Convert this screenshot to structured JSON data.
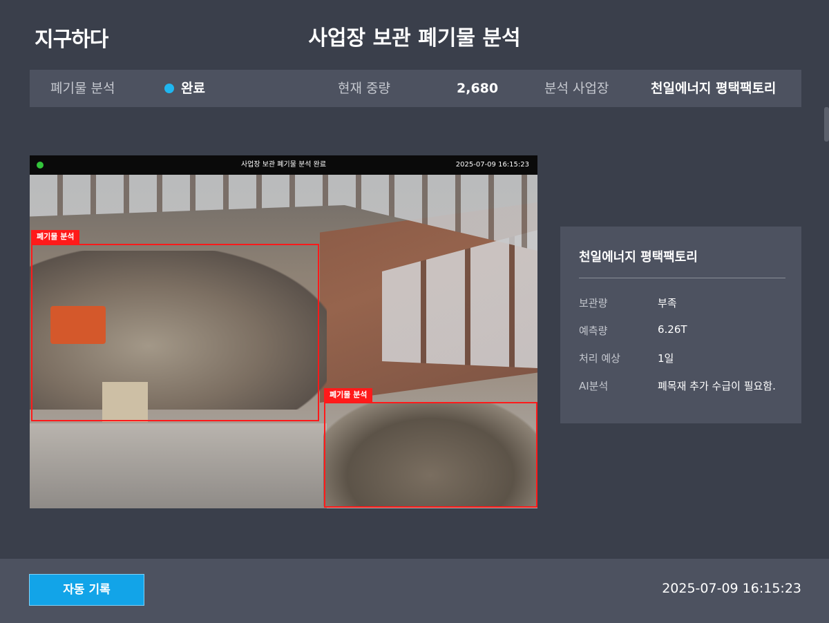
{
  "header": {
    "logo": "지구하다",
    "title": "사업장 보관 폐기물 분석"
  },
  "status": {
    "analysis_label": "폐기물 분석",
    "analysis_value": "완료",
    "analysis_dot_color": "#1fb6f0",
    "weight_label": "현재 중량",
    "weight_value": "2,680",
    "site_label": "분석 사업장",
    "site_value": "천일에너지 평택팩토리"
  },
  "camera": {
    "title": "사업장 보관 폐기물 분석 완료",
    "timestamp": "2025-07-09 16:15:23",
    "live_dot_color": "#33c43b",
    "detections": [
      {
        "label": "폐기물 분석"
      },
      {
        "label": "폐기물 분석"
      }
    ]
  },
  "info": {
    "title": "천일에너지 평택팩토리",
    "rows": [
      {
        "key": "보관량",
        "value": "부족"
      },
      {
        "key": "예측량",
        "value": "6.26T"
      },
      {
        "key": "처리 예상",
        "value": "1일"
      },
      {
        "key": "AI분석",
        "value": "폐목재 추가 수급이 필요함."
      }
    ]
  },
  "footer": {
    "button_label": "자동 기록",
    "timestamp": "2025-07-09 16:15:23"
  },
  "colors": {
    "background": "#3a3f4b",
    "panel": "#4d5260",
    "accent": "#12a4e8",
    "detection": "#ff1a1a"
  }
}
